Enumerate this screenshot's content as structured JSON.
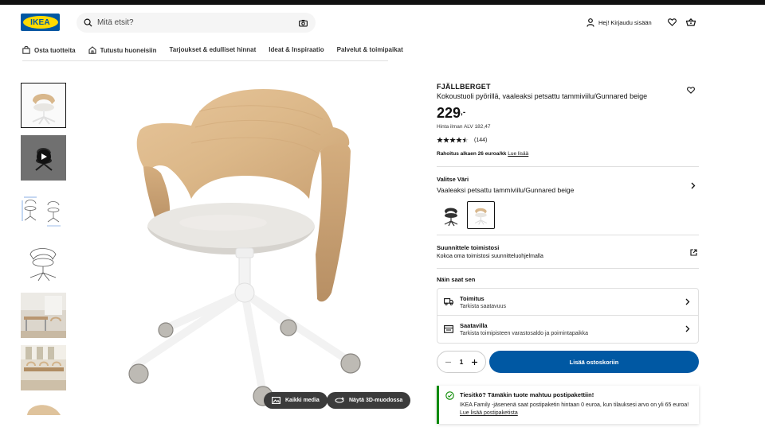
{
  "header": {
    "logo_text": "IKEA",
    "search_placeholder": "Mitä etsit?",
    "login_label": "Hej! Kirjaudu sisään"
  },
  "nav": {
    "items": [
      {
        "label": "Osta tuotteita",
        "icon": "shopping-bag-icon"
      },
      {
        "label": "Tutustu huoneisiin",
        "icon": "house-icon"
      },
      {
        "label": "Tarjoukset & edulliset hinnat"
      },
      {
        "label": "Ideat & Inspiraatio"
      },
      {
        "label": "Palvelut & toimipaikat"
      }
    ]
  },
  "gallery": {
    "all_media_label": "Kaikki media",
    "show_3d_label": "Näytä 3D-muodossa"
  },
  "product": {
    "name": "FJÄLLBERGET",
    "description": "Kokoustuoli pyörillä, vaaleaksi petsattu tammiviilu/Gunnared beige",
    "price_integer": "229",
    "price_suffix": ",-",
    "price_excl_vat": "Hinta ilman ALV 182,47",
    "rating": 4.5,
    "review_count": "(144)",
    "financing_text": "Rahoitus alkaen 26 euroa/kk",
    "financing_link": "Lue lisää"
  },
  "color_select": {
    "title": "Valitse Väri",
    "selected": "Vaaleaksi petsattu tammiviilu/Gunnared beige"
  },
  "planner": {
    "title": "Suunnittele toimistosi",
    "subtitle": "Kokoa oma toimistosi suunnitteluohjelmalla"
  },
  "availability": {
    "heading": "Näin saat sen",
    "delivery_title": "Toimitus",
    "delivery_sub": "Tarkista saatavuus",
    "store_title": "Saatavilla",
    "store_sub": "Tarkista toimipisteen varastosaldo ja poimintapaikka"
  },
  "cart": {
    "quantity": "1",
    "add_label": "Lisää ostoskoriin"
  },
  "notice": {
    "title": "Tiesitkö? Tämäkin tuote mahtuu postipakettiin!",
    "text": "IKEA Family -jäsenenä saat postipaketin hintaan 0 euroa, kun tilauksesi arvo on yli 65 euroa!",
    "link": "Lue lisää postipaketista"
  },
  "colors": {
    "brand_blue": "#0058a3",
    "brand_yellow": "#ffdb00",
    "success_green": "#0a8a00"
  }
}
